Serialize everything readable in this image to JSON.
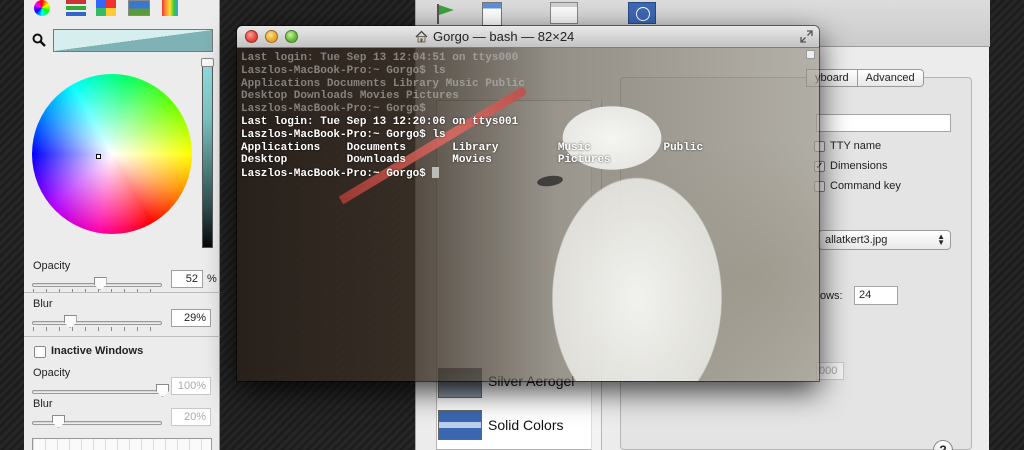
{
  "color_panel": {
    "toolbar": [
      "color-wheel-icon",
      "color-sliders-icon",
      "color-palettes-icon",
      "image-palettes-icon",
      "crayons-icon"
    ],
    "opacity_label": "Opacity",
    "opacity_value": "52",
    "percent_sign": "%",
    "blur_label": "Blur",
    "blur_value": "29%",
    "inactive_label": "Inactive Windows",
    "inactive_checked": false,
    "inactive_opacity_label": "Opacity",
    "inactive_opacity_value": "100%",
    "inactive_blur_label": "Blur",
    "inactive_blur_value": "20%",
    "opacity_level": 0.52,
    "blur_level": 0.29,
    "inactive_opacity_level": 1.0,
    "inactive_blur_level": 0.2
  },
  "terminal": {
    "title": "Gorgo — bash — 82×24",
    "ghost_lines": [
      "Last login: Tue Sep 13 12:04:51 on ttys000",
      "Laszlos-MacBook-Pro:~ Gorgo$ ls",
      "Applications Documents Library Music Public",
      "Desktop Downloads Movies Pictures",
      "Laszlos-MacBook-Pro:~ Gorgo$"
    ],
    "lines": [
      "Last login: Tue Sep 13 12:20:06 on ttys001",
      "Laszlos-MacBook-Pro:~ Gorgo$ ls",
      "Applications    Documents       Library         Music           Public",
      "Desktop         Downloads       Movies          Pictures",
      "Laszlos-MacBook-Pro:~ Gorgo$ "
    ]
  },
  "preferences": {
    "toolbar_icons": [
      "startup-icon",
      "settings-icon",
      "window-groups-icon",
      "encodings-icon"
    ],
    "tabs": [
      {
        "label": "yboard"
      },
      {
        "label": "Advanced"
      }
    ],
    "options": [
      {
        "label": "TTY name",
        "checked": false
      },
      {
        "label": "Dimensions",
        "checked": true
      },
      {
        "label": "Command key",
        "checked": false
      }
    ],
    "background_image": "allatkert3.jpg",
    "rows_label": "ows:",
    "rows_value": "24",
    "scrollback_value": "000",
    "help_label": "?",
    "profiles": [
      {
        "name": "Silver Aerogel"
      },
      {
        "name": "Solid Colors"
      }
    ]
  }
}
